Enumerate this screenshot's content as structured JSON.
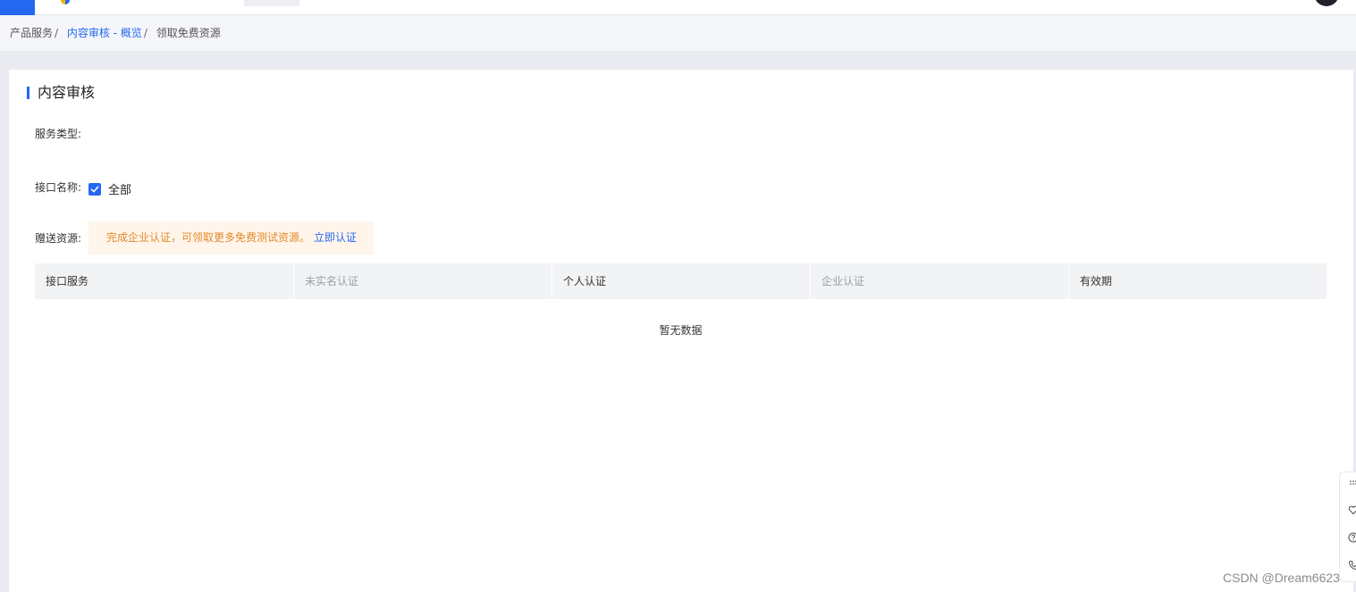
{
  "breadcrumb": {
    "root": "产品服务",
    "separator": "/",
    "parent": "内容审核 - 概览",
    "current": "领取免费资源"
  },
  "section": {
    "title": "内容审核"
  },
  "fields": {
    "service_type_label": "服务类型:",
    "interface_name_label": "接口名称:",
    "all_checkbox_label": "全部",
    "all_checked": true,
    "gift_resource_label": "赠送资源:"
  },
  "notice": {
    "text": "完成企业认证，可领取更多免费测试资源。",
    "action": "立即认证"
  },
  "table": {
    "columns": [
      "接口服务",
      "未实名认证",
      "个人认证",
      "企业认证",
      "有效期"
    ],
    "empty_text": "暂无数据"
  },
  "colors": {
    "accent": "#2468f2",
    "notice_text": "#e38a2a",
    "notice_bg": "#fff5eb"
  },
  "side_tools": [
    "grid-icon",
    "heart-icon",
    "help-icon",
    "phone-icon"
  ],
  "watermark": "CSDN @Dream6623"
}
